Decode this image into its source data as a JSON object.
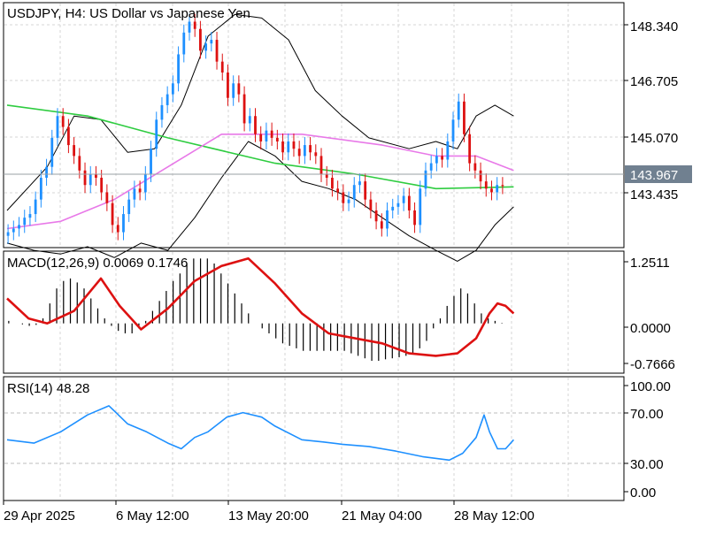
{
  "main_panel": {
    "title": "USDJPY, H4:  US Dollar vs Japanese Yen",
    "price_ticks": [
      "148.340",
      "146.705",
      "145.070",
      "143.435"
    ],
    "current_price": "143.967",
    "ylim": [
      142.3,
      149.0
    ]
  },
  "macd_panel": {
    "label": "MACD(12,26,9) 0.0069 0.1746",
    "ticks": [
      "1.2511",
      "0.0000",
      "-0.7666"
    ],
    "ylim": [
      -0.98,
      1.43
    ]
  },
  "rsi_panel": {
    "label": "RSI(14) 48.28",
    "ticks": [
      "100.00",
      "70.00",
      "30.00",
      "0.00"
    ],
    "ylim": [
      -5,
      103
    ]
  },
  "x_axis": {
    "labels": [
      "29 Apr 2025",
      "6 May 12:00",
      "13 May 20:00",
      "21 May 04:00",
      "28 May 12:00"
    ]
  },
  "colors": {
    "bull": "#1e90ff",
    "bear": "#dd1111",
    "ma_slow": "#2ecc40",
    "ma_fast": "#e879e8",
    "bands": "#000000",
    "macd_signal": "#dd1111",
    "macd_hist": "#000000",
    "rsi": "#1e90ff",
    "price_label_bg": "#708090"
  },
  "chart_data": [
    {
      "type": "candlestick",
      "title": "USDJPY, H4:  US Dollar vs Japanese Yen",
      "ylim": [
        142.3,
        149.0
      ],
      "close": [
        142.7,
        142.8,
        142.9,
        143.1,
        143.2,
        143.6,
        144.2,
        144.5,
        145.3,
        145.9,
        145.6,
        145.1,
        144.8,
        144.4,
        144.0,
        144.3,
        144.2,
        143.8,
        143.5,
        142.9,
        142.7,
        143.2,
        143.6,
        143.9,
        143.8,
        144.3,
        145.0,
        145.8,
        146.2,
        146.5,
        146.8,
        147.6,
        148.2,
        148.5,
        148.3,
        147.7,
        147.9,
        148.0,
        147.4,
        147.1,
        146.4,
        146.8,
        146.5,
        145.7,
        145.9,
        145.4,
        145.2,
        145.5,
        145.3,
        145.2,
        144.9,
        145.2,
        145.0,
        144.8,
        145.1,
        144.9,
        144.8,
        144.3,
        144.2,
        143.9,
        143.8,
        143.5,
        143.6,
        144.0,
        144.1,
        143.6,
        143.3,
        143.0,
        142.8,
        143.3,
        143.4,
        143.5,
        143.7,
        143.3,
        142.9,
        143.9,
        144.4,
        144.6,
        144.8,
        144.7,
        145.2,
        145.8,
        146.3,
        145.4,
        144.6,
        144.4,
        144.1,
        143.9,
        143.8,
        144.0,
        143.97
      ],
      "ma_slow_points": [
        [
          0,
          146.2
        ],
        [
          30,
          145.9
        ],
        [
          60,
          145.3
        ],
        [
          100,
          144.6
        ],
        [
          130,
          144.3
        ],
        [
          160,
          143.9
        ],
        [
          189,
          143.95
        ]
      ],
      "ma_fast_points": [
        [
          0,
          142.8
        ],
        [
          20,
          143.0
        ],
        [
          40,
          143.6
        ],
        [
          60,
          144.5
        ],
        [
          80,
          145.4
        ],
        [
          110,
          145.4
        ],
        [
          140,
          145.1
        ],
        [
          160,
          144.8
        ],
        [
          175,
          144.8
        ],
        [
          189,
          144.4
        ]
      ],
      "bb_upper_points": [
        [
          0,
          143.3
        ],
        [
          15,
          144.5
        ],
        [
          25,
          145.9
        ],
        [
          35,
          145.8
        ],
        [
          45,
          144.9
        ],
        [
          55,
          145.0
        ],
        [
          65,
          146.2
        ],
        [
          75,
          148.1
        ],
        [
          85,
          148.7
        ],
        [
          95,
          148.6
        ],
        [
          105,
          148.0
        ],
        [
          115,
          146.6
        ],
        [
          125,
          145.9
        ],
        [
          135,
          145.3
        ],
        [
          150,
          145.0
        ],
        [
          160,
          145.2
        ],
        [
          168,
          145.0
        ],
        [
          175,
          145.9
        ],
        [
          182,
          146.2
        ],
        [
          189,
          145.9
        ]
      ],
      "bb_lower_points": [
        [
          0,
          142.4
        ],
        [
          10,
          142.2
        ],
        [
          20,
          142.1
        ],
        [
          30,
          142.3
        ],
        [
          40,
          142.0
        ],
        [
          50,
          142.4
        ],
        [
          60,
          142.2
        ],
        [
          70,
          143.1
        ],
        [
          80,
          144.2
        ],
        [
          90,
          145.2
        ],
        [
          100,
          144.8
        ],
        [
          110,
          144.1
        ],
        [
          120,
          143.9
        ],
        [
          130,
          143.6
        ],
        [
          140,
          143.1
        ],
        [
          150,
          142.6
        ],
        [
          160,
          142.2
        ],
        [
          168,
          141.9
        ],
        [
          175,
          142.2
        ],
        [
          182,
          142.9
        ],
        [
          189,
          143.4
        ]
      ]
    },
    {
      "type": "bar",
      "title": "MACD(12,26,9) 0.0069 0.1746",
      "ylim": [
        -0.98,
        1.43
      ],
      "histogram": [
        0.05,
        0.0,
        -0.02,
        -0.05,
        -0.03,
        0.1,
        0.4,
        0.7,
        0.85,
        0.9,
        0.82,
        0.7,
        0.5,
        0.3,
        0.1,
        -0.05,
        -0.15,
        -0.2,
        -0.2,
        -0.1,
        0.05,
        0.25,
        0.45,
        0.65,
        0.85,
        1.0,
        1.2,
        1.3,
        1.3,
        1.3,
        1.2,
        1.0,
        0.8,
        0.6,
        0.4,
        0.2,
        0.0,
        -0.1,
        -0.2,
        -0.3,
        -0.4,
        -0.45,
        -0.5,
        -0.55,
        -0.55,
        -0.55,
        -0.55,
        -0.55,
        -0.55,
        -0.55,
        -0.6,
        -0.65,
        -0.7,
        -0.75,
        -0.75,
        -0.72,
        -0.7,
        -0.68,
        -0.65,
        -0.6,
        -0.5,
        -0.35,
        -0.1,
        0.1,
        0.35,
        0.55,
        0.7,
        0.6,
        0.4,
        0.2,
        0.1,
        0.05,
        0.01
      ],
      "signal_points": [
        [
          0,
          0.5
        ],
        [
          8,
          0.1
        ],
        [
          15,
          0.0
        ],
        [
          25,
          0.25
        ],
        [
          35,
          0.9
        ],
        [
          42,
          0.35
        ],
        [
          50,
          -0.12
        ],
        [
          60,
          0.3
        ],
        [
          70,
          0.85
        ],
        [
          80,
          1.15
        ],
        [
          90,
          1.3
        ],
        [
          100,
          0.8
        ],
        [
          110,
          0.2
        ],
        [
          120,
          -0.2
        ],
        [
          140,
          -0.4
        ],
        [
          150,
          -0.6
        ],
        [
          160,
          -0.65
        ],
        [
          168,
          -0.6
        ],
        [
          175,
          -0.3
        ],
        [
          180,
          0.2
        ],
        [
          183,
          0.4
        ],
        [
          186,
          0.35
        ],
        [
          189,
          0.2
        ]
      ]
    },
    {
      "type": "line",
      "title": "RSI(14) 48.28",
      "ylim": [
        -5,
        103
      ],
      "levels": [
        70,
        30
      ],
      "rsi_points": [
        [
          0,
          48
        ],
        [
          10,
          45
        ],
        [
          20,
          55
        ],
        [
          30,
          70
        ],
        [
          38,
          78
        ],
        [
          45,
          62
        ],
        [
          52,
          55
        ],
        [
          60,
          45
        ],
        [
          65,
          40
        ],
        [
          70,
          50
        ],
        [
          75,
          55
        ],
        [
          82,
          68
        ],
        [
          88,
          72
        ],
        [
          95,
          68
        ],
        [
          100,
          60
        ],
        [
          110,
          48
        ],
        [
          118,
          46
        ],
        [
          125,
          44
        ],
        [
          135,
          42
        ],
        [
          145,
          38
        ],
        [
          155,
          33
        ],
        [
          165,
          30
        ],
        [
          170,
          36
        ],
        [
          175,
          50
        ],
        [
          178,
          70
        ],
        [
          180,
          55
        ],
        [
          183,
          40
        ],
        [
          186,
          40
        ],
        [
          189,
          48
        ]
      ]
    }
  ]
}
